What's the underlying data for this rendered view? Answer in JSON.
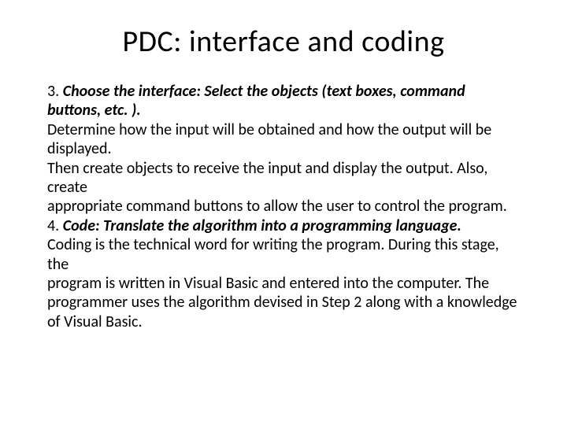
{
  "title": "PDC: interface and coding",
  "content": {
    "step3_heading_prefix": "3. ",
    "step3_heading": "Choose the interface: Select the objects (text boxes, command buttons, etc. ).",
    "step3_line1": "Determine how the input will be obtained and how the output will be displayed.",
    "step3_line2": "Then create objects to receive the input and display the output. Also, create",
    "step3_line3": "appropriate command buttons to allow the user to control the program.",
    "step4_heading_prefix": "4. ",
    "step4_heading": "Code: Translate the algorithm into a programming language.",
    "step4_line1": "Coding is the technical word for writing the program. During this stage, the",
    "step4_line2": "program is written in Visual Basic and entered into the computer. The programmer uses the algorithm devised in Step 2 along with a knowledge of Visual Basic."
  }
}
